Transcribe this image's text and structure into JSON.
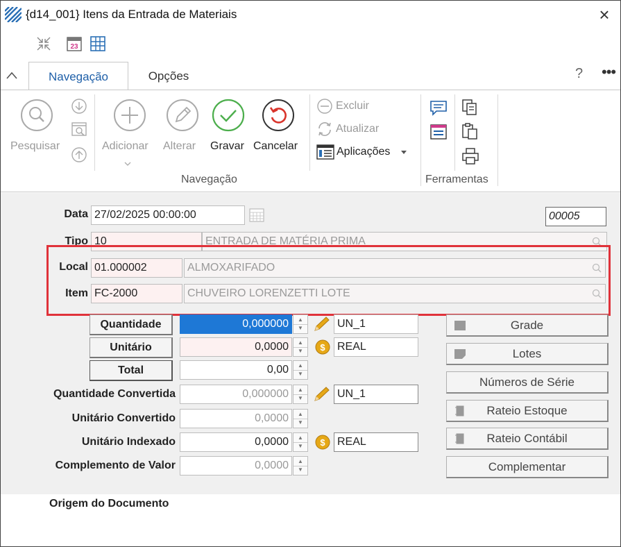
{
  "window": {
    "title": "{d14_001} Itens da Entrada de Materiais"
  },
  "tabs": [
    {
      "label": "Navegação"
    },
    {
      "label": "Opções"
    }
  ],
  "help": "?",
  "more": "•••",
  "ribbon": {
    "pesquisar": "Pesquisar",
    "adicionar": "Adicionar",
    "alterar": "Alterar",
    "gravar": "Gravar",
    "cancelar": "Cancelar",
    "excluir": "Excluir",
    "atualizar": "Atualizar",
    "aplicacoes": "Aplicações",
    "group_navegacao": "Navegação",
    "group_ferramentas": "Ferramentas"
  },
  "colors": {
    "accent": "#1e5fa8",
    "selection": "#1e78d6",
    "highlight": "#e0323a",
    "ok_green": "#4cae4c",
    "cancel_red": "#d9342b",
    "coin": "#e6a817"
  },
  "form": {
    "data": {
      "label": "Data",
      "value": "27/02/2025 00:00:00"
    },
    "numero": "00005",
    "tipo": {
      "label": "Tipo",
      "code": "10",
      "desc": "ENTRADA DE MATÉRIA PRIMA"
    },
    "local": {
      "label": "Local",
      "code": "01.000002",
      "desc": "ALMOXARIFADO"
    },
    "item": {
      "label": "Item",
      "code": "FC-2000",
      "desc": "CHUVEIRO LORENZETTI LOTE"
    },
    "quantidade": {
      "label": "Quantidade",
      "value": "0,000000",
      "unit": "UN_1"
    },
    "unitario": {
      "label": "Unitário",
      "value": "0,0000",
      "unit": "REAL"
    },
    "total": {
      "label": "Total",
      "value": "0,00"
    },
    "quantidade_convertida": {
      "label": "Quantidade Convertida",
      "value": "0,000000",
      "unit": "UN_1"
    },
    "unitario_convertido": {
      "label": "Unitário Convertido",
      "value": "0,0000"
    },
    "unitario_indexado": {
      "label": "Unitário Indexado",
      "value": "0,0000",
      "unit": "REAL"
    },
    "complemento_valor": {
      "label": "Complemento de Valor",
      "value": "0,0000"
    }
  },
  "side_buttons": {
    "grade": "Grade",
    "lotes": "Lotes",
    "numeros_serie": "Números de Série",
    "rateio_estoque": "Rateio Estoque",
    "rateio_contabil": "Rateio Contábil",
    "complementar": "Complementar"
  },
  "footer": {
    "origem": "Origem do Documento"
  }
}
